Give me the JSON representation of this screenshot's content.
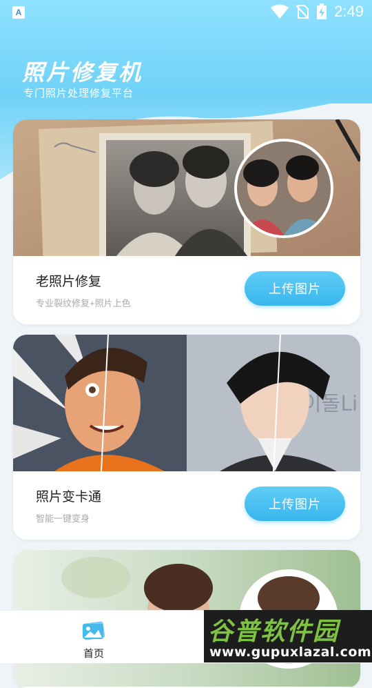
{
  "status_bar": {
    "time": "2:49",
    "app_icon_letter": "A",
    "icons": [
      "wifi-icon",
      "no-sim-icon",
      "battery-charging-icon"
    ]
  },
  "header": {
    "title": "照片修复机",
    "subtitle": "专门照片处理修复平台"
  },
  "cards": [
    {
      "title": "老照片修复",
      "desc": "专业裂纹修复+照片上色",
      "button": "上传图片"
    },
    {
      "title": "照片变卡通",
      "desc": "智能一键变身",
      "button": "上传图片"
    },
    {
      "title": "",
      "desc": "",
      "button": ""
    }
  ],
  "bottom_nav": {
    "home_label": "首页",
    "home_icon": "gallery-icon"
  },
  "watermark": {
    "brand": "谷普软件园",
    "url": "www.gupuxlazal.com"
  },
  "colors": {
    "accent": "#39b6ee",
    "header_top": "#8fe1ff",
    "watermark_green": "#7dc242"
  }
}
